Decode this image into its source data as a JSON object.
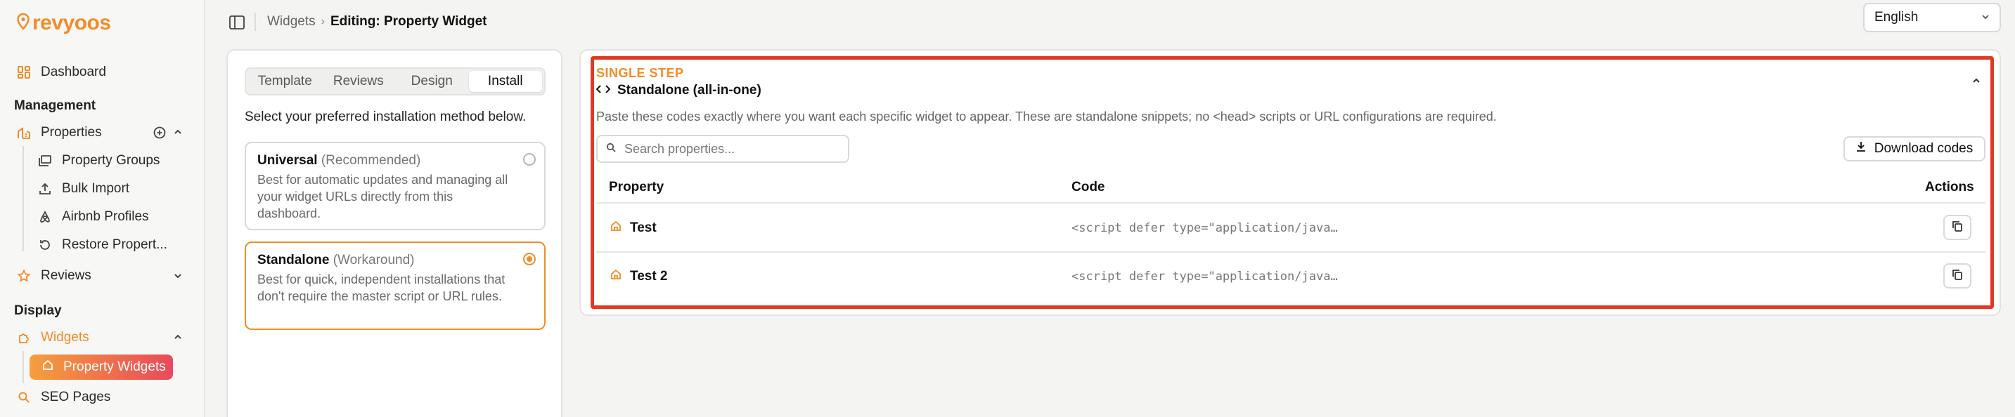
{
  "app": {
    "logo_text": "revyoos"
  },
  "sidebar": {
    "dashboard": "Dashboard",
    "management_title": "Management",
    "properties": "Properties",
    "property_groups": "Property Groups",
    "bulk_import": "Bulk Import",
    "airbnb_profiles": "Airbnb Profiles",
    "restore_properties": "Restore Propert...",
    "reviews": "Reviews",
    "display_title": "Display",
    "widgets": "Widgets",
    "property_widgets": "Property Widgets",
    "seo_pages": "SEO Pages"
  },
  "breadcrumb": {
    "root": "Widgets",
    "current": "Editing: Property Widget"
  },
  "language": {
    "selected": "English"
  },
  "left_panel": {
    "tabs": [
      "Template",
      "Reviews",
      "Design",
      "Install"
    ],
    "active_tab": "Install",
    "instruction": "Select your preferred installation method below.",
    "options": [
      {
        "title": "Universal",
        "qualifier": "(Recommended)",
        "description": "Best for automatic updates and managing all your widget URLs directly from this dashboard.",
        "selected": false
      },
      {
        "title": "Standalone",
        "qualifier": "(Workaround)",
        "description": "Best for quick, independent installations that don't require the master script or URL rules.",
        "selected": true
      }
    ]
  },
  "install_panel": {
    "step_label": "SINGLE STEP",
    "title": "Standalone (all-in-one)",
    "description": "Paste these codes exactly where you want each specific widget to appear. These are standalone snippets; no <head> scripts or URL configurations are required.",
    "search_placeholder": "Search properties...",
    "download_label": "Download codes",
    "columns": {
      "property": "Property",
      "code": "Code",
      "actions": "Actions"
    },
    "rows": [
      {
        "property": "Test",
        "code": "<script defer type=\"application/java…"
      },
      {
        "property": "Test 2",
        "code": "<script defer type=\"application/java…"
      }
    ]
  },
  "colors": {
    "accent": "#f28c28",
    "highlight": "#e03a24",
    "pill_start": "#f4a03c",
    "pill_end": "#e9495a"
  }
}
